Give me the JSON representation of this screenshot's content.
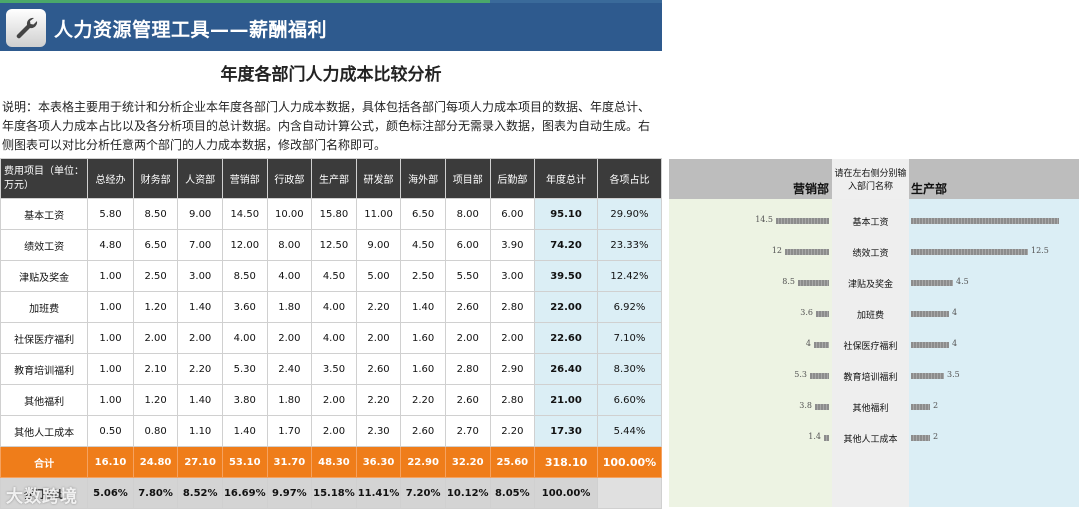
{
  "header": {
    "title": "人力资源管理工具——薪酬福利"
  },
  "page_title": "年度各部门人力成本比较分析",
  "description": "说明：本表格主要用于统计和分析企业本年度各部门人力成本数据，具体包括各部门每项人力成本项目的数据、年度总计、年度各项人力成本占比以及各分析项目的总计数据。内含自动计算公式，颜色标注部分无需录入数据，图表为自动生成。右侧图表可以对比分析任意两个部门的人力成本数据，修改部门名称即可。",
  "table": {
    "headers": [
      "费用项目（单位：万元）",
      "总经办",
      "财务部",
      "人资部",
      "营销部",
      "行政部",
      "生产部",
      "研发部",
      "海外部",
      "项目部",
      "后勤部",
      "年度总计",
      "各项占比"
    ],
    "rows": [
      [
        "基本工资",
        "5.80",
        "8.50",
        "9.00",
        "14.50",
        "10.00",
        "15.80",
        "11.00",
        "6.50",
        "8.00",
        "6.00",
        "95.10",
        "29.90%"
      ],
      [
        "绩效工资",
        "4.80",
        "6.50",
        "7.00",
        "12.00",
        "8.00",
        "12.50",
        "9.00",
        "4.50",
        "6.00",
        "3.90",
        "74.20",
        "23.33%"
      ],
      [
        "津贴及奖金",
        "1.00",
        "2.50",
        "3.00",
        "8.50",
        "4.00",
        "4.50",
        "5.00",
        "2.50",
        "5.50",
        "3.00",
        "39.50",
        "12.42%"
      ],
      [
        "加班费",
        "1.00",
        "1.20",
        "1.40",
        "3.60",
        "1.80",
        "4.00",
        "2.20",
        "1.40",
        "2.60",
        "2.80",
        "22.00",
        "6.92%"
      ],
      [
        "社保医疗福利",
        "1.00",
        "2.00",
        "2.00",
        "4.00",
        "2.00",
        "4.00",
        "2.00",
        "1.60",
        "2.00",
        "2.00",
        "22.60",
        "7.10%"
      ],
      [
        "教育培训福利",
        "1.00",
        "2.10",
        "2.20",
        "5.30",
        "2.40",
        "3.50",
        "2.60",
        "1.60",
        "2.80",
        "2.90",
        "26.40",
        "8.30%"
      ],
      [
        "其他福利",
        "1.00",
        "1.20",
        "1.40",
        "3.80",
        "1.80",
        "2.00",
        "2.20",
        "2.20",
        "2.60",
        "2.80",
        "21.00",
        "6.60%"
      ],
      [
        "其他人工成本",
        "0.50",
        "0.80",
        "1.10",
        "1.40",
        "1.70",
        "2.00",
        "2.30",
        "2.60",
        "2.70",
        "2.20",
        "17.30",
        "5.44%"
      ]
    ],
    "sum_row": [
      "合计",
      "16.10",
      "24.80",
      "27.10",
      "53.10",
      "31.70",
      "48.30",
      "36.30",
      "22.90",
      "32.20",
      "25.60",
      "318.10",
      "100.00%"
    ],
    "ratio_row": [
      "部门占比",
      "5.06%",
      "7.80%",
      "8.52%",
      "16.69%",
      "9.97%",
      "15.18%",
      "11.41%",
      "7.20%",
      "10.12%",
      "8.05%",
      "100.00%",
      ""
    ]
  },
  "watermark": "大数跨境",
  "chart_data": {
    "type": "bar",
    "orientation": "horizontal-butterfly",
    "note": "请在左右侧分别输入部门名称",
    "categories": [
      "基本工资",
      "绩效工资",
      "津贴及奖金",
      "加班费",
      "社保医疗福利",
      "教育培训福利",
      "其他福利",
      "其他人工成本"
    ],
    "series": [
      {
        "name": "营销部",
        "side": "left",
        "values": [
          14.5,
          12,
          8.5,
          3.6,
          4,
          5.3,
          3.8,
          1.4
        ]
      },
      {
        "name": "生产部",
        "side": "right",
        "values": [
          15.8,
          12.5,
          4.5,
          4,
          4,
          3.5,
          2,
          2
        ]
      }
    ],
    "data_labels_left": [
      "14.5",
      "12",
      "8.5",
      "3.6",
      "4",
      "5.3",
      "3.8",
      "1.4"
    ],
    "data_labels_right": [
      "",
      "12.5",
      "4.5",
      "4",
      "4",
      "3.5",
      "2",
      "2"
    ],
    "colors": {
      "bar": "#9a9a9a",
      "left_bg": "#edf3e3",
      "right_bg": "#dbeef5",
      "sum_row": "#ef7d1a",
      "header": "#2e5a8e"
    }
  }
}
